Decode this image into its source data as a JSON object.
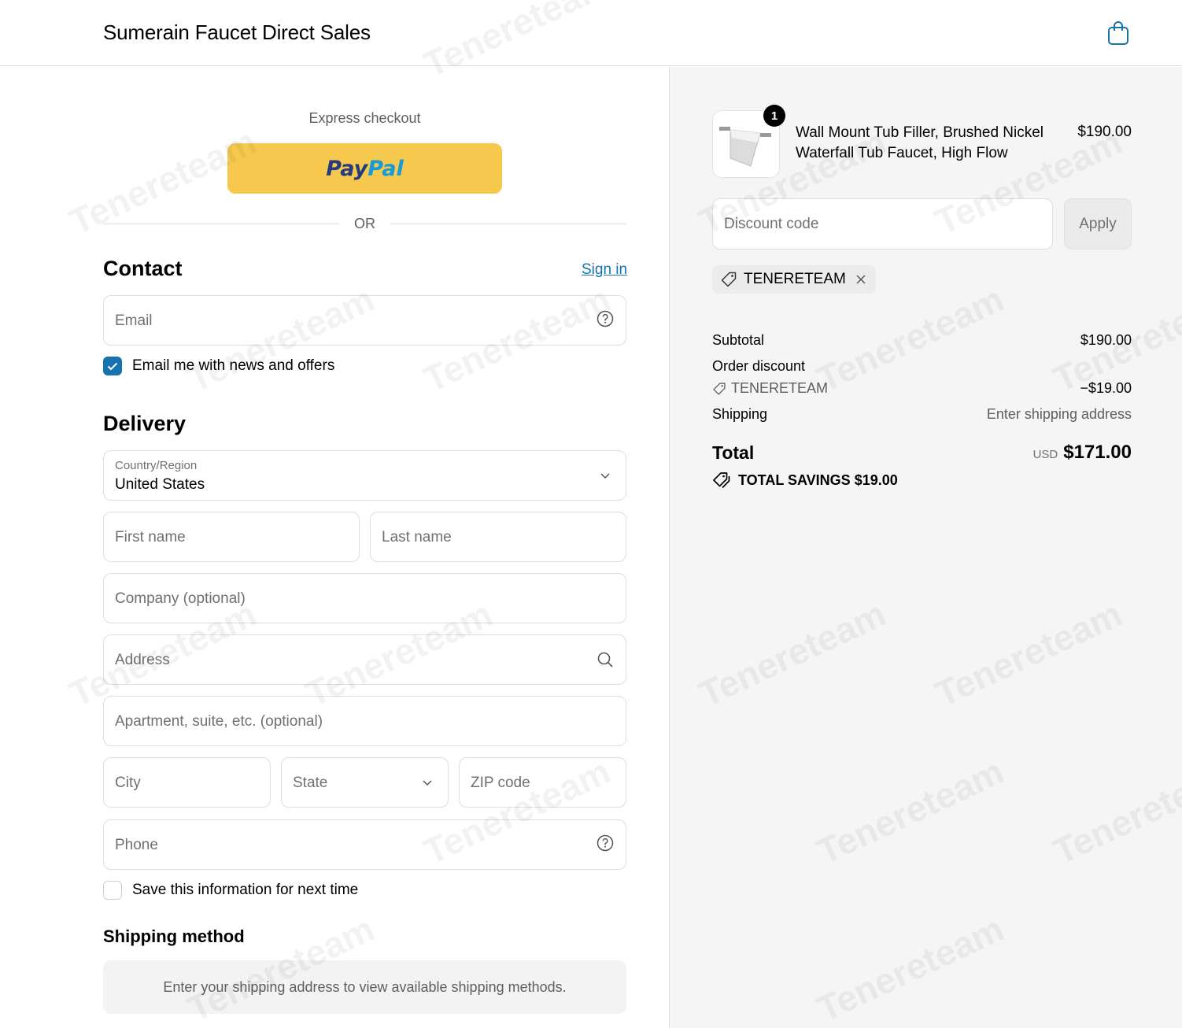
{
  "header": {
    "brand": "Sumerain Faucet Direct Sales",
    "cart_icon": "shopping-bag-icon"
  },
  "express": {
    "title": "Express checkout",
    "paypal_part1": "Pay",
    "paypal_part2": "Pal",
    "or_label": "OR"
  },
  "contact": {
    "title": "Contact",
    "sign_in": "Sign in",
    "email_placeholder": "Email",
    "newsletter_label": "Email me with news and offers",
    "newsletter_checked": true
  },
  "delivery": {
    "title": "Delivery",
    "country_label": "Country/Region",
    "country_value": "United States",
    "first_name": "First name",
    "last_name": "Last name",
    "company": "Company (optional)",
    "address": "Address",
    "apartment": "Apartment, suite, etc. (optional)",
    "city": "City",
    "state": "State",
    "zip": "ZIP code",
    "phone": "Phone",
    "save_info_label": "Save this information for next time",
    "save_info_checked": false
  },
  "shipping_method": {
    "title": "Shipping method",
    "message": "Enter your shipping address to view available shipping methods."
  },
  "order": {
    "item": {
      "quantity": "1",
      "name": "Wall Mount Tub Filler, Brushed Nickel Waterfall Tub Faucet, High Flow",
      "price": "$190.00"
    },
    "discount_placeholder": "Discount code",
    "apply_label": "Apply",
    "applied_code": "TENERETEAM",
    "subtotal_label": "Subtotal",
    "subtotal_value": "$190.00",
    "order_discount_label": "Order discount",
    "discount_code": "TENERETEAM",
    "discount_value": "−$19.00",
    "shipping_label": "Shipping",
    "shipping_value": "Enter shipping address",
    "total_label": "Total",
    "currency": "USD",
    "total_value": "$171.00",
    "savings_label": "TOTAL SAVINGS",
    "savings_value": "$19.00"
  },
  "watermark": "Tenereteam",
  "colors": {
    "accent": "#1773b0",
    "paypal_button": "#f6c94e",
    "sidebar_bg": "#f5f5f5"
  }
}
